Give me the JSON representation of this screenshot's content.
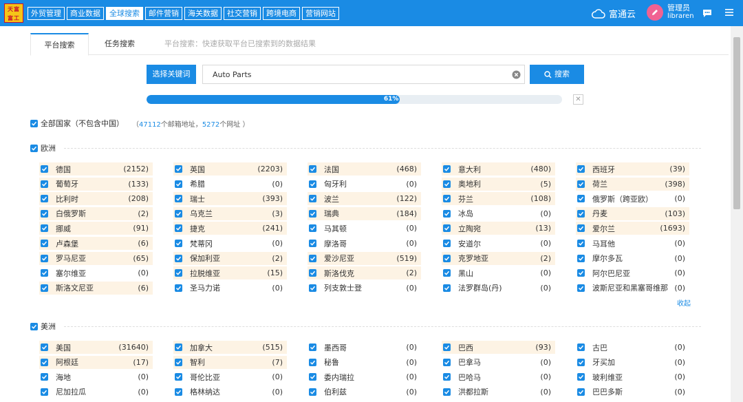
{
  "logo": {
    "text": "天富富工"
  },
  "nav": [
    {
      "label": "外贸管理",
      "active": false
    },
    {
      "label": "商业数据",
      "active": false
    },
    {
      "label": "全球搜索",
      "active": true
    },
    {
      "label": "邮件营销",
      "active": false
    },
    {
      "label": "海关数据",
      "active": false
    },
    {
      "label": "社交营销",
      "active": false
    },
    {
      "label": "跨境电商",
      "active": false
    },
    {
      "label": "营销网站",
      "active": false
    }
  ],
  "brand": "富通云",
  "user": {
    "name": "管理员",
    "sub": "libraren"
  },
  "tabs": {
    "platform": "平台搜索",
    "task": "任务搜索",
    "hint": "平台搜索：快速获取平台已搜索到的数据结果"
  },
  "search": {
    "keyword_button": "选择关键词",
    "value": "Auto Parts",
    "button": "搜索"
  },
  "progress": {
    "label": "61%",
    "value": 0.61
  },
  "all_countries": {
    "label": "全部国家（不包含中国）",
    "prefix": "（",
    "emails": "47112",
    "emails_suffix": "个邮箱地址，",
    "urls": "5272",
    "urls_suffix": "个网址 ）"
  },
  "colors": {
    "accent": "#1a8be4",
    "highlight": "#fdf3e4"
  },
  "europe": {
    "label": "欧洲",
    "collapse": "收起",
    "countries": [
      {
        "name": "德国",
        "count": "(2152)",
        "hl": true
      },
      {
        "name": "英国",
        "count": "(2203)",
        "hl": true
      },
      {
        "name": "法国",
        "count": "(468)",
        "hl": true
      },
      {
        "name": "意大利",
        "count": "(480)",
        "hl": true
      },
      {
        "name": "西班牙",
        "count": "(39)",
        "hl": true
      },
      {
        "name": "葡萄牙",
        "count": "(133)",
        "hl": true
      },
      {
        "name": "希腊",
        "count": "(0)",
        "hl": false
      },
      {
        "name": "匈牙利",
        "count": "(0)",
        "hl": false
      },
      {
        "name": "奥地利",
        "count": "(5)",
        "hl": true
      },
      {
        "name": "荷兰",
        "count": "(398)",
        "hl": true
      },
      {
        "name": "比利时",
        "count": "(208)",
        "hl": true
      },
      {
        "name": "瑞士",
        "count": "(393)",
        "hl": true
      },
      {
        "name": "波兰",
        "count": "(122)",
        "hl": true
      },
      {
        "name": "芬兰",
        "count": "(108)",
        "hl": true
      },
      {
        "name": "俄罗斯（跨亚欧）",
        "count": "(0)",
        "hl": false
      },
      {
        "name": "白俄罗斯",
        "count": "(2)",
        "hl": true
      },
      {
        "name": "乌克兰",
        "count": "(3)",
        "hl": true
      },
      {
        "name": "瑞典",
        "count": "(184)",
        "hl": true
      },
      {
        "name": "冰岛",
        "count": "(0)",
        "hl": false
      },
      {
        "name": "丹麦",
        "count": "(103)",
        "hl": true
      },
      {
        "name": "挪威",
        "count": "(91)",
        "hl": true
      },
      {
        "name": "捷克",
        "count": "(241)",
        "hl": true
      },
      {
        "name": "马其顿",
        "count": "(0)",
        "hl": false
      },
      {
        "name": "立陶宛",
        "count": "(13)",
        "hl": true
      },
      {
        "name": "爱尔兰",
        "count": "(1693)",
        "hl": true
      },
      {
        "name": "卢森堡",
        "count": "(6)",
        "hl": true
      },
      {
        "name": "梵蒂冈",
        "count": "(0)",
        "hl": false
      },
      {
        "name": "摩洛哥",
        "count": "(0)",
        "hl": false
      },
      {
        "name": "安道尔",
        "count": "(0)",
        "hl": false
      },
      {
        "name": "马耳他",
        "count": "(0)",
        "hl": false
      },
      {
        "name": "罗马尼亚",
        "count": "(65)",
        "hl": true
      },
      {
        "name": "保加利亚",
        "count": "(2)",
        "hl": true
      },
      {
        "name": "爱沙尼亚",
        "count": "(519)",
        "hl": true
      },
      {
        "name": "克罗地亚",
        "count": "(2)",
        "hl": true
      },
      {
        "name": "摩尔多瓦",
        "count": "(0)",
        "hl": false
      },
      {
        "name": "塞尔维亚",
        "count": "(0)",
        "hl": false
      },
      {
        "name": "拉脱维亚",
        "count": "(15)",
        "hl": true
      },
      {
        "name": "斯洛伐克",
        "count": "(2)",
        "hl": true
      },
      {
        "name": "黑山",
        "count": "(0)",
        "hl": false
      },
      {
        "name": "阿尔巴尼亚",
        "count": "(0)",
        "hl": false
      },
      {
        "name": "斯洛文尼亚",
        "count": "(6)",
        "hl": true
      },
      {
        "name": "圣马力诺",
        "count": "(0)",
        "hl": false
      },
      {
        "name": "列支敦士登",
        "count": "(0)",
        "hl": false
      },
      {
        "name": "法罗群岛(丹)",
        "count": "(0)",
        "hl": false
      },
      {
        "name": "波斯尼亚和黑塞哥维那",
        "count": "(0)",
        "hl": false
      }
    ]
  },
  "america": {
    "label": "美洲",
    "countries": [
      {
        "name": "美国",
        "count": "(31640)",
        "hl": true
      },
      {
        "name": "加拿大",
        "count": "(515)",
        "hl": true
      },
      {
        "name": "墨西哥",
        "count": "(0)",
        "hl": false
      },
      {
        "name": "巴西",
        "count": "(93)",
        "hl": true
      },
      {
        "name": "古巴",
        "count": "(0)",
        "hl": false
      },
      {
        "name": "阿根廷",
        "count": "(17)",
        "hl": true
      },
      {
        "name": "智利",
        "count": "(7)",
        "hl": true
      },
      {
        "name": "秘鲁",
        "count": "(0)",
        "hl": false
      },
      {
        "name": "巴拿马",
        "count": "(0)",
        "hl": false
      },
      {
        "name": "牙买加",
        "count": "(0)",
        "hl": false
      },
      {
        "name": "海地",
        "count": "(0)",
        "hl": false
      },
      {
        "name": "哥伦比亚",
        "count": "(0)",
        "hl": false
      },
      {
        "name": "委内瑞拉",
        "count": "(0)",
        "hl": false
      },
      {
        "name": "巴哈马",
        "count": "(0)",
        "hl": false
      },
      {
        "name": "玻利维亚",
        "count": "(0)",
        "hl": false
      },
      {
        "name": "尼加拉瓜",
        "count": "(0)",
        "hl": false
      },
      {
        "name": "格林纳达",
        "count": "(0)",
        "hl": false
      },
      {
        "name": "伯利兹",
        "count": "(0)",
        "hl": false
      },
      {
        "name": "洪都拉斯",
        "count": "(0)",
        "hl": false
      },
      {
        "name": "巴巴多斯",
        "count": "(0)",
        "hl": false
      }
    ]
  }
}
